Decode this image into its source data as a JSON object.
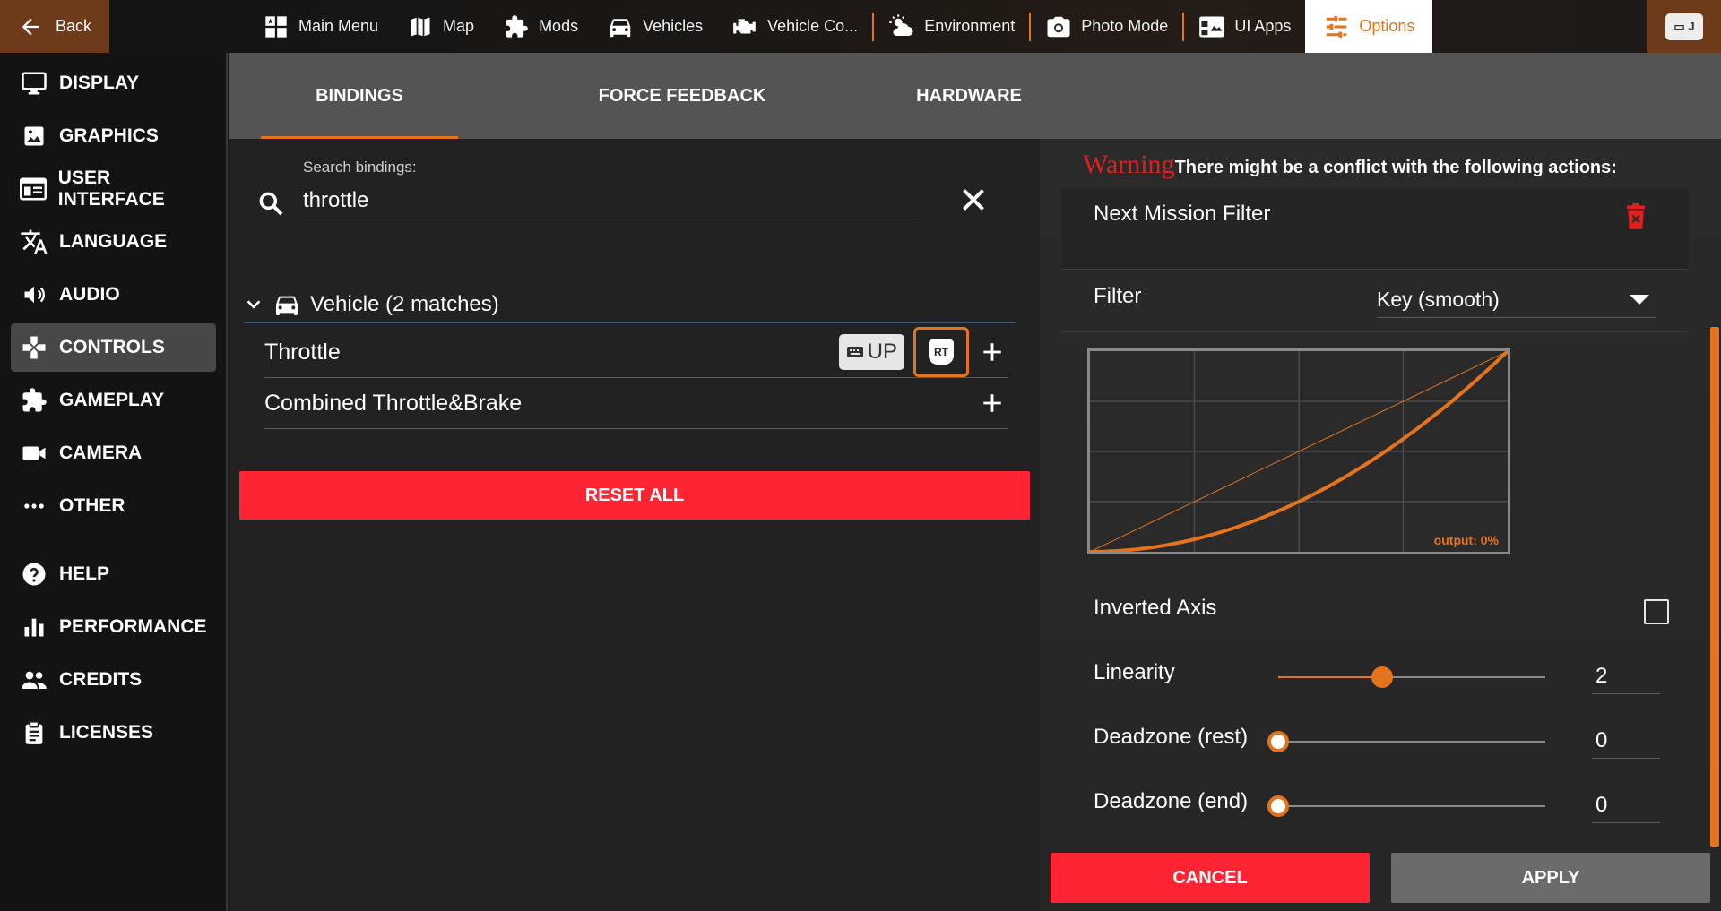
{
  "topbar": {
    "back_label": "Back",
    "tabs": [
      {
        "label": "Main Menu",
        "icon": "main-menu-icon"
      },
      {
        "label": "Map",
        "icon": "map-icon"
      },
      {
        "label": "Mods",
        "icon": "puzzle-icon"
      },
      {
        "label": "Vehicles",
        "icon": "car-icon"
      },
      {
        "label": "Vehicle Co...",
        "icon": "engine-icon"
      },
      {
        "label": "Environment",
        "icon": "weather-icon"
      },
      {
        "label": "Photo Mode",
        "icon": "camera-icon"
      },
      {
        "label": "UI Apps",
        "icon": "ui-apps-icon"
      },
      {
        "label": "Options",
        "icon": "sliders-icon"
      }
    ],
    "right_key": "J",
    "accent": "#e3731c"
  },
  "sidebar": {
    "items": [
      {
        "label": "DISPLAY",
        "icon": "monitor-icon"
      },
      {
        "label": "GRAPHICS",
        "icon": "image-icon"
      },
      {
        "label": "USER INTERFACE",
        "icon": "interface-icon"
      },
      {
        "label": "LANGUAGE",
        "icon": "translate-icon"
      },
      {
        "label": "AUDIO",
        "icon": "speaker-icon"
      },
      {
        "label": "CONTROLS",
        "icon": "gamepad-icon"
      },
      {
        "label": "GAMEPLAY",
        "icon": "puzzle-icon"
      },
      {
        "label": "CAMERA",
        "icon": "video-camera-icon"
      },
      {
        "label": "OTHER",
        "icon": "more-icon"
      },
      {
        "label": "HELP",
        "icon": "help-icon"
      },
      {
        "label": "PERFORMANCE",
        "icon": "bar-chart-icon"
      },
      {
        "label": "CREDITS",
        "icon": "people-icon"
      },
      {
        "label": "LICENSES",
        "icon": "clipboard-icon"
      }
    ],
    "active": "CONTROLS"
  },
  "content_tabs": {
    "bindings": "BINDINGS",
    "force_feedback": "FORCE FEEDBACK",
    "hardware": "HARDWARE"
  },
  "bindings": {
    "search_label": "Search bindings:",
    "search_value": "throttle",
    "group_label": "Vehicle (2 matches)",
    "rows": [
      {
        "name": "Throttle",
        "key_label": "UP",
        "pad_label": "RT"
      },
      {
        "name": "Combined Throttle&Brake"
      }
    ],
    "reset_label": "RESET ALL"
  },
  "editor": {
    "warning_word": "Warning",
    "warning_text": "There might be a conflict with the following actions:",
    "conflict_action": "Next Mission Filter",
    "filter_label": "Filter",
    "filter_value": "Key (smooth)",
    "curve_output_label": "output: 0%",
    "inverted_label": "Inverted Axis",
    "inverted_checked": false,
    "linearity_label": "Linearity",
    "linearity_value": "2",
    "linearity_fraction": 0.39,
    "deadzone_rest_label": "Deadzone (rest)",
    "deadzone_rest_value": "0",
    "deadzone_end_label": "Deadzone (end)",
    "deadzone_end_value": "0",
    "cancel_label": "CANCEL",
    "apply_label": "APPLY"
  },
  "colors": {
    "accent": "#e3731c",
    "danger": "#ff2434",
    "warning": "#e0201f"
  }
}
